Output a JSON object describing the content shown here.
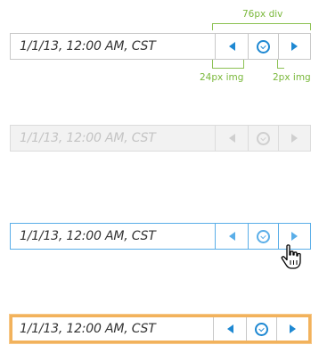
{
  "annotations": {
    "div_width": "76px div",
    "img_width": "24px img",
    "gap_width": "2px img"
  },
  "pickers": [
    {
      "state": "normal",
      "value": "1/1/13, 12:00 AM, CST"
    },
    {
      "state": "disabled",
      "value": "1/1/13, 12:00 AM, CST"
    },
    {
      "state": "hover",
      "value": "1/1/13, 12:00 AM, CST"
    },
    {
      "state": "focus",
      "value": "1/1/13, 12:00 AM, CST"
    }
  ],
  "icons": {
    "previous": "triangle-left-icon",
    "clock": "clock-icon",
    "next": "triangle-right-icon",
    "cursor": "hand-pointer-icon"
  },
  "colors": {
    "annotation": "#7ab83b",
    "accent": "#1e88d2",
    "hover": "#5aaee8",
    "focus": "#f2b25c",
    "border": "#c8c8c8",
    "disabled_text": "#c4c4c4"
  }
}
